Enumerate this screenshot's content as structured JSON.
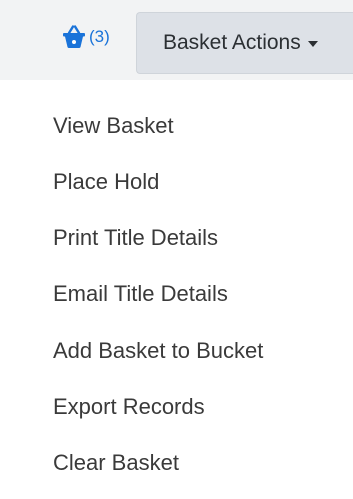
{
  "header": {
    "basket_count": "(3)",
    "basket_icon": "basket-icon",
    "actions_label": "Basket Actions",
    "actions_caret_icon": "caret-down-icon"
  },
  "menu": {
    "items": [
      {
        "label": "View Basket"
      },
      {
        "label": "Place Hold"
      },
      {
        "label": "Print Title Details"
      },
      {
        "label": "Email Title Details"
      },
      {
        "label": "Add Basket to Bucket"
      },
      {
        "label": "Export Records"
      },
      {
        "label": "Clear Basket"
      }
    ]
  },
  "colors": {
    "link": "#1a73d9",
    "button_bg": "#dde1e7",
    "topbar_bg": "#f2f3f4",
    "menu_text": "#3a3a3a"
  }
}
